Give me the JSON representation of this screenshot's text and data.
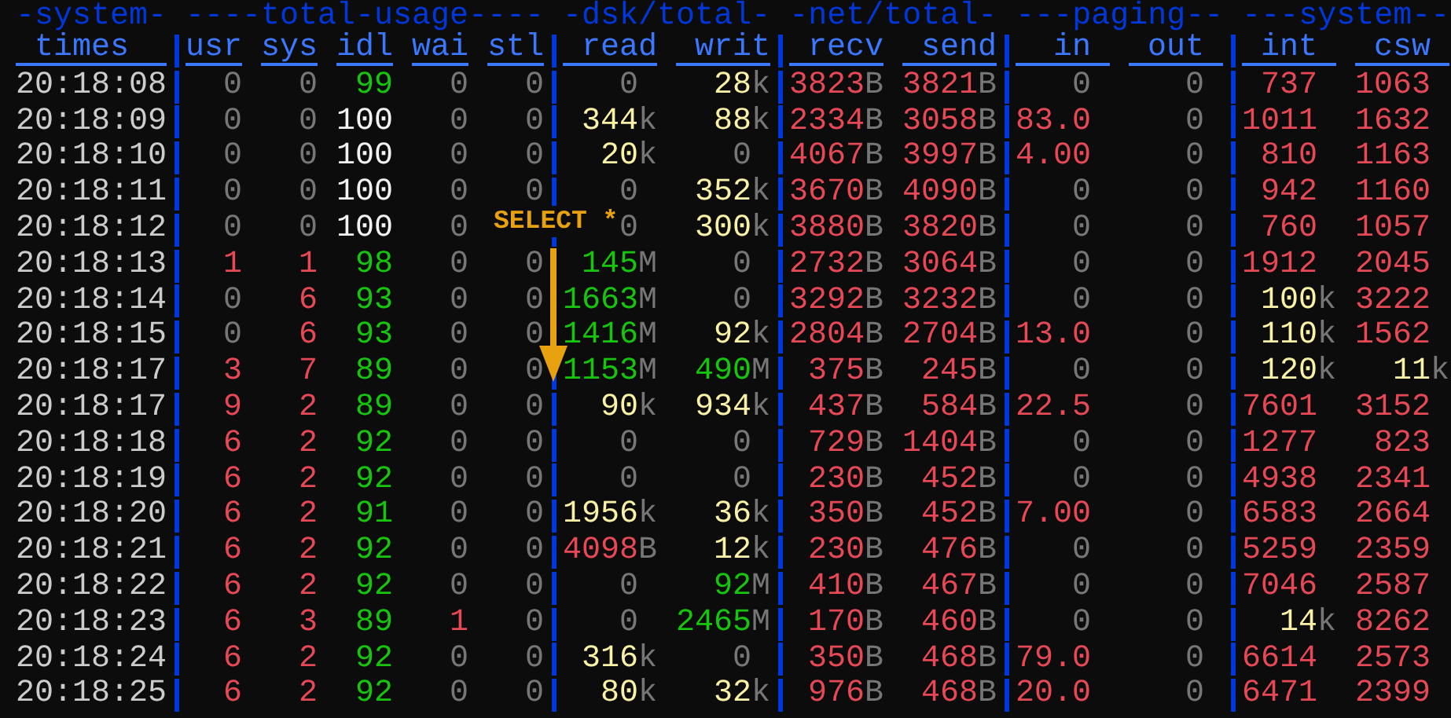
{
  "groups": [
    {
      "label": "-system-",
      "columns": [
        {
          "label": "times",
          "kind": "time"
        }
      ]
    },
    {
      "label": "----total-usage----",
      "columns": [
        {
          "label": "usr",
          "kind": "percent"
        },
        {
          "label": "sys",
          "kind": "percent"
        },
        {
          "label": "idl",
          "kind": "percent"
        },
        {
          "label": "wai",
          "kind": "percent"
        },
        {
          "label": "stl",
          "kind": "percent"
        }
      ]
    },
    {
      "label": "-dsk/total-",
      "columns": [
        {
          "label": "read",
          "kind": "value"
        },
        {
          "label": "writ",
          "kind": "value"
        }
      ]
    },
    {
      "label": "-net/total-",
      "columns": [
        {
          "label": "recv",
          "kind": "value"
        },
        {
          "label": "send",
          "kind": "value"
        }
      ]
    },
    {
      "label": "---paging--",
      "columns": [
        {
          "label": "in",
          "kind": "value"
        },
        {
          "label": "out",
          "kind": "value"
        }
      ]
    },
    {
      "label": "---system--",
      "columns": [
        {
          "label": "int",
          "kind": "value"
        },
        {
          "label": "csw",
          "kind": "value"
        }
      ]
    }
  ],
  "rows": [
    {
      "time": "20:18:08",
      "cells": [
        {
          "value": "0",
          "color": "#767676"
        },
        {
          "value": "0",
          "color": "#767676"
        },
        {
          "value": "99",
          "color": "#16c60c"
        },
        {
          "value": "0",
          "color": "#767676"
        },
        {
          "value": "0",
          "color": "#767676"
        },
        {
          "value": "0",
          "color": "#767676"
        },
        {
          "value": "28",
          "unit": "k",
          "color": "#f9f1a5"
        },
        {
          "value": "3823",
          "unit": "B",
          "color": "#e74856"
        },
        {
          "value": "3821",
          "unit": "B",
          "color": "#e74856"
        },
        {
          "value": "0",
          "color": "#767676"
        },
        {
          "value": "0",
          "color": "#767676"
        },
        {
          "value": "737",
          "color": "#e74856"
        },
        {
          "value": "1063",
          "color": "#e74856"
        }
      ]
    },
    {
      "time": "20:18:09",
      "cells": [
        {
          "value": "0",
          "color": "#767676"
        },
        {
          "value": "0",
          "color": "#767676"
        },
        {
          "value": "100",
          "color": "#f2f2f2"
        },
        {
          "value": "0",
          "color": "#767676"
        },
        {
          "value": "0",
          "color": "#767676"
        },
        {
          "value": "344",
          "unit": "k",
          "color": "#f9f1a5"
        },
        {
          "value": "88",
          "unit": "k",
          "color": "#f9f1a5"
        },
        {
          "value": "2334",
          "unit": "B",
          "color": "#e74856"
        },
        {
          "value": "3058",
          "unit": "B",
          "color": "#e74856"
        },
        {
          "value": "83.0",
          "color": "#e74856"
        },
        {
          "value": "0",
          "color": "#767676"
        },
        {
          "value": "1011",
          "color": "#e74856"
        },
        {
          "value": "1632",
          "color": "#e74856"
        }
      ]
    },
    {
      "time": "20:18:10",
      "cells": [
        {
          "value": "0",
          "color": "#767676"
        },
        {
          "value": "0",
          "color": "#767676"
        },
        {
          "value": "100",
          "color": "#f2f2f2"
        },
        {
          "value": "0",
          "color": "#767676"
        },
        {
          "value": "0",
          "color": "#767676"
        },
        {
          "value": "20",
          "unit": "k",
          "color": "#f9f1a5"
        },
        {
          "value": "0",
          "color": "#767676"
        },
        {
          "value": "4067",
          "unit": "B",
          "color": "#e74856"
        },
        {
          "value": "3997",
          "unit": "B",
          "color": "#e74856"
        },
        {
          "value": "4.00",
          "color": "#e74856"
        },
        {
          "value": "0",
          "color": "#767676"
        },
        {
          "value": "810",
          "color": "#e74856"
        },
        {
          "value": "1163",
          "color": "#e74856"
        }
      ]
    },
    {
      "time": "20:18:11",
      "cells": [
        {
          "value": "0",
          "color": "#767676"
        },
        {
          "value": "0",
          "color": "#767676"
        },
        {
          "value": "100",
          "color": "#f2f2f2"
        },
        {
          "value": "0",
          "color": "#767676"
        },
        {
          "value": "0",
          "color": "#767676"
        },
        {
          "value": "0",
          "color": "#767676"
        },
        {
          "value": "352",
          "unit": "k",
          "color": "#f9f1a5"
        },
        {
          "value": "3670",
          "unit": "B",
          "color": "#e74856"
        },
        {
          "value": "4090",
          "unit": "B",
          "color": "#e74856"
        },
        {
          "value": "0",
          "color": "#767676"
        },
        {
          "value": "0",
          "color": "#767676"
        },
        {
          "value": "942",
          "color": "#e74856"
        },
        {
          "value": "1160",
          "color": "#e74856"
        }
      ]
    },
    {
      "time": "20:18:12",
      "cells": [
        {
          "value": "0",
          "color": "#767676"
        },
        {
          "value": "0",
          "color": "#767676"
        },
        {
          "value": "100",
          "color": "#f2f2f2"
        },
        {
          "value": "0",
          "color": "#767676"
        },
        {},
        {
          "value": "0",
          "color": "#767676"
        },
        {
          "value": "300",
          "unit": "k",
          "color": "#f9f1a5"
        },
        {
          "value": "3880",
          "unit": "B",
          "color": "#e74856"
        },
        {
          "value": "3820",
          "unit": "B",
          "color": "#e74856"
        },
        {
          "value": "0",
          "color": "#767676"
        },
        {
          "value": "0",
          "color": "#767676"
        },
        {
          "value": "760",
          "color": "#e74856"
        },
        {
          "value": "1057",
          "color": "#e74856"
        }
      ]
    },
    {
      "time": "20:18:13",
      "cells": [
        {
          "value": "1",
          "color": "#e74856"
        },
        {
          "value": "1",
          "color": "#e74856"
        },
        {
          "value": "98",
          "color": "#16c60c"
        },
        {
          "value": "0",
          "color": "#767676"
        },
        {
          "value": "0",
          "color": "#767676"
        },
        {
          "value": "145",
          "unit": "M",
          "color": "#16c60c"
        },
        {
          "value": "0",
          "color": "#767676"
        },
        {
          "value": "2732",
          "unit": "B",
          "color": "#e74856"
        },
        {
          "value": "3064",
          "unit": "B",
          "color": "#e74856"
        },
        {
          "value": "0",
          "color": "#767676"
        },
        {
          "value": "0",
          "color": "#767676"
        },
        {
          "value": "1912",
          "color": "#e74856"
        },
        {
          "value": "2045",
          "color": "#e74856"
        }
      ]
    },
    {
      "time": "20:18:14",
      "cells": [
        {
          "value": "0",
          "color": "#767676"
        },
        {
          "value": "6",
          "color": "#e74856"
        },
        {
          "value": "93",
          "color": "#16c60c"
        },
        {
          "value": "0",
          "color": "#767676"
        },
        {
          "value": "0",
          "color": "#767676"
        },
        {
          "value": "1663",
          "unit": "M",
          "color": "#16c60c"
        },
        {
          "value": "0",
          "color": "#767676"
        },
        {
          "value": "3292",
          "unit": "B",
          "color": "#e74856"
        },
        {
          "value": "3232",
          "unit": "B",
          "color": "#e74856"
        },
        {
          "value": "0",
          "color": "#767676"
        },
        {
          "value": "0",
          "color": "#767676"
        },
        {
          "value": "100",
          "unit": "k",
          "color": "#f9f1a5"
        },
        {
          "value": "3222",
          "color": "#e74856"
        }
      ]
    },
    {
      "time": "20:18:15",
      "cells": [
        {
          "value": "0",
          "color": "#767676"
        },
        {
          "value": "6",
          "color": "#e74856"
        },
        {
          "value": "93",
          "color": "#16c60c"
        },
        {
          "value": "0",
          "color": "#767676"
        },
        {
          "value": "0",
          "color": "#767676"
        },
        {
          "value": "1416",
          "unit": "M",
          "color": "#16c60c"
        },
        {
          "value": "92",
          "unit": "k",
          "color": "#f9f1a5"
        },
        {
          "value": "2804",
          "unit": "B",
          "color": "#e74856"
        },
        {
          "value": "2704",
          "unit": "B",
          "color": "#e74856"
        },
        {
          "value": "13.0",
          "color": "#e74856"
        },
        {
          "value": "0",
          "color": "#767676"
        },
        {
          "value": "110",
          "unit": "k",
          "color": "#f9f1a5"
        },
        {
          "value": "1562",
          "color": "#e74856"
        }
      ]
    },
    {
      "time": "20:18:17",
      "cells": [
        {
          "value": "3",
          "color": "#e74856"
        },
        {
          "value": "7",
          "color": "#e74856"
        },
        {
          "value": "89",
          "color": "#16c60c"
        },
        {
          "value": "0",
          "color": "#767676"
        },
        {
          "value": "0",
          "color": "#767676"
        },
        {
          "value": "1153",
          "unit": "M",
          "color": "#16c60c"
        },
        {
          "value": "490",
          "unit": "M",
          "color": "#16c60c"
        },
        {
          "value": "375",
          "unit": "B",
          "color": "#e74856"
        },
        {
          "value": "245",
          "unit": "B",
          "color": "#e74856"
        },
        {
          "value": "0",
          "color": "#767676"
        },
        {
          "value": "0",
          "color": "#767676"
        },
        {
          "value": "120",
          "unit": "k",
          "color": "#f9f1a5"
        },
        {
          "value": "11",
          "unit": "k",
          "color": "#f9f1a5"
        }
      ]
    },
    {
      "time": "20:18:17",
      "cells": [
        {
          "value": "9",
          "color": "#e74856"
        },
        {
          "value": "2",
          "color": "#e74856"
        },
        {
          "value": "89",
          "color": "#16c60c"
        },
        {
          "value": "0",
          "color": "#767676"
        },
        {
          "value": "0",
          "color": "#767676"
        },
        {
          "value": "90",
          "unit": "k",
          "color": "#f9f1a5"
        },
        {
          "value": "934",
          "unit": "k",
          "color": "#f9f1a5"
        },
        {
          "value": "437",
          "unit": "B",
          "color": "#e74856"
        },
        {
          "value": "584",
          "unit": "B",
          "color": "#e74856"
        },
        {
          "value": "22.5",
          "color": "#e74856"
        },
        {
          "value": "0",
          "color": "#767676"
        },
        {
          "value": "7601",
          "color": "#e74856"
        },
        {
          "value": "3152",
          "color": "#e74856"
        }
      ]
    },
    {
      "time": "20:18:18",
      "cells": [
        {
          "value": "6",
          "color": "#e74856"
        },
        {
          "value": "2",
          "color": "#e74856"
        },
        {
          "value": "92",
          "color": "#16c60c"
        },
        {
          "value": "0",
          "color": "#767676"
        },
        {
          "value": "0",
          "color": "#767676"
        },
        {
          "value": "0",
          "color": "#767676"
        },
        {
          "value": "0",
          "color": "#767676"
        },
        {
          "value": "729",
          "unit": "B",
          "color": "#e74856"
        },
        {
          "value": "1404",
          "unit": "B",
          "color": "#e74856"
        },
        {
          "value": "0",
          "color": "#767676"
        },
        {
          "value": "0",
          "color": "#767676"
        },
        {
          "value": "1277",
          "color": "#e74856"
        },
        {
          "value": "823",
          "color": "#e74856"
        }
      ]
    },
    {
      "time": "20:18:19",
      "cells": [
        {
          "value": "6",
          "color": "#e74856"
        },
        {
          "value": "2",
          "color": "#e74856"
        },
        {
          "value": "92",
          "color": "#16c60c"
        },
        {
          "value": "0",
          "color": "#767676"
        },
        {
          "value": "0",
          "color": "#767676"
        },
        {
          "value": "0",
          "color": "#767676"
        },
        {
          "value": "0",
          "color": "#767676"
        },
        {
          "value": "230",
          "unit": "B",
          "color": "#e74856"
        },
        {
          "value": "452",
          "unit": "B",
          "color": "#e74856"
        },
        {
          "value": "0",
          "color": "#767676"
        },
        {
          "value": "0",
          "color": "#767676"
        },
        {
          "value": "4938",
          "color": "#e74856"
        },
        {
          "value": "2341",
          "color": "#e74856"
        }
      ]
    },
    {
      "time": "20:18:20",
      "cells": [
        {
          "value": "6",
          "color": "#e74856"
        },
        {
          "value": "2",
          "color": "#e74856"
        },
        {
          "value": "91",
          "color": "#16c60c"
        },
        {
          "value": "0",
          "color": "#767676"
        },
        {
          "value": "0",
          "color": "#767676"
        },
        {
          "value": "1956",
          "unit": "k",
          "color": "#f9f1a5"
        },
        {
          "value": "36",
          "unit": "k",
          "color": "#f9f1a5"
        },
        {
          "value": "350",
          "unit": "B",
          "color": "#e74856"
        },
        {
          "value": "452",
          "unit": "B",
          "color": "#e74856"
        },
        {
          "value": "7.00",
          "color": "#e74856"
        },
        {
          "value": "0",
          "color": "#767676"
        },
        {
          "value": "6583",
          "color": "#e74856"
        },
        {
          "value": "2664",
          "color": "#e74856"
        }
      ]
    },
    {
      "time": "20:18:21",
      "cells": [
        {
          "value": "6",
          "color": "#e74856"
        },
        {
          "value": "2",
          "color": "#e74856"
        },
        {
          "value": "92",
          "color": "#16c60c"
        },
        {
          "value": "0",
          "color": "#767676"
        },
        {
          "value": "0",
          "color": "#767676"
        },
        {
          "value": "4098",
          "unit": "B",
          "color": "#e74856"
        },
        {
          "value": "12",
          "unit": "k",
          "color": "#f9f1a5"
        },
        {
          "value": "230",
          "unit": "B",
          "color": "#e74856"
        },
        {
          "value": "476",
          "unit": "B",
          "color": "#e74856"
        },
        {
          "value": "0",
          "color": "#767676"
        },
        {
          "value": "0",
          "color": "#767676"
        },
        {
          "value": "5259",
          "color": "#e74856"
        },
        {
          "value": "2359",
          "color": "#e74856"
        }
      ]
    },
    {
      "time": "20:18:22",
      "cells": [
        {
          "value": "6",
          "color": "#e74856"
        },
        {
          "value": "2",
          "color": "#e74856"
        },
        {
          "value": "92",
          "color": "#16c60c"
        },
        {
          "value": "0",
          "color": "#767676"
        },
        {
          "value": "0",
          "color": "#767676"
        },
        {
          "value": "0",
          "color": "#767676"
        },
        {
          "value": "92",
          "unit": "M",
          "color": "#16c60c"
        },
        {
          "value": "410",
          "unit": "B",
          "color": "#e74856"
        },
        {
          "value": "467",
          "unit": "B",
          "color": "#e74856"
        },
        {
          "value": "0",
          "color": "#767676"
        },
        {
          "value": "0",
          "color": "#767676"
        },
        {
          "value": "7046",
          "color": "#e74856"
        },
        {
          "value": "2587",
          "color": "#e74856"
        }
      ]
    },
    {
      "time": "20:18:23",
      "cells": [
        {
          "value": "6",
          "color": "#e74856"
        },
        {
          "value": "3",
          "color": "#e74856"
        },
        {
          "value": "89",
          "color": "#16c60c"
        },
        {
          "value": "1",
          "color": "#e74856"
        },
        {
          "value": "0",
          "color": "#767676"
        },
        {
          "value": "0",
          "color": "#767676"
        },
        {
          "value": "2465",
          "unit": "M",
          "color": "#16c60c"
        },
        {
          "value": "170",
          "unit": "B",
          "color": "#e74856"
        },
        {
          "value": "460",
          "unit": "B",
          "color": "#e74856"
        },
        {
          "value": "0",
          "color": "#767676"
        },
        {
          "value": "0",
          "color": "#767676"
        },
        {
          "value": "14",
          "unit": "k",
          "color": "#f9f1a5"
        },
        {
          "value": "8262",
          "color": "#e74856"
        }
      ]
    },
    {
      "time": "20:18:24",
      "cells": [
        {
          "value": "6",
          "color": "#e74856"
        },
        {
          "value": "2",
          "color": "#e74856"
        },
        {
          "value": "92",
          "color": "#16c60c"
        },
        {
          "value": "0",
          "color": "#767676"
        },
        {
          "value": "0",
          "color": "#767676"
        },
        {
          "value": "316",
          "unit": "k",
          "color": "#f9f1a5"
        },
        {
          "value": "0",
          "color": "#767676"
        },
        {
          "value": "350",
          "unit": "B",
          "color": "#e74856"
        },
        {
          "value": "468",
          "unit": "B",
          "color": "#e74856"
        },
        {
          "value": "79.0",
          "color": "#e74856"
        },
        {
          "value": "0",
          "color": "#767676"
        },
        {
          "value": "6614",
          "color": "#e74856"
        },
        {
          "value": "2573",
          "color": "#e74856"
        }
      ]
    },
    {
      "time": "20:18:25",
      "cells": [
        {
          "value": "6",
          "color": "#e74856"
        },
        {
          "value": "2",
          "color": "#e74856"
        },
        {
          "value": "92",
          "color": "#16c60c"
        },
        {
          "value": "0",
          "color": "#767676"
        },
        {
          "value": "0",
          "color": "#767676"
        },
        {
          "value": "80",
          "unit": "k",
          "color": "#f9f1a5"
        },
        {
          "value": "32",
          "unit": "k",
          "color": "#f9f1a5"
        },
        {
          "value": "976",
          "unit": "B",
          "color": "#e74856"
        },
        {
          "value": "468",
          "unit": "B",
          "color": "#e74856"
        },
        {
          "value": "20.0",
          "color": "#e74856"
        },
        {
          "value": "0",
          "color": "#767676"
        },
        {
          "value": "6471",
          "color": "#e74856"
        },
        {
          "value": "2399",
          "color": "#e74856"
        }
      ]
    }
  ],
  "annotation": {
    "label": "SELECT *"
  }
}
